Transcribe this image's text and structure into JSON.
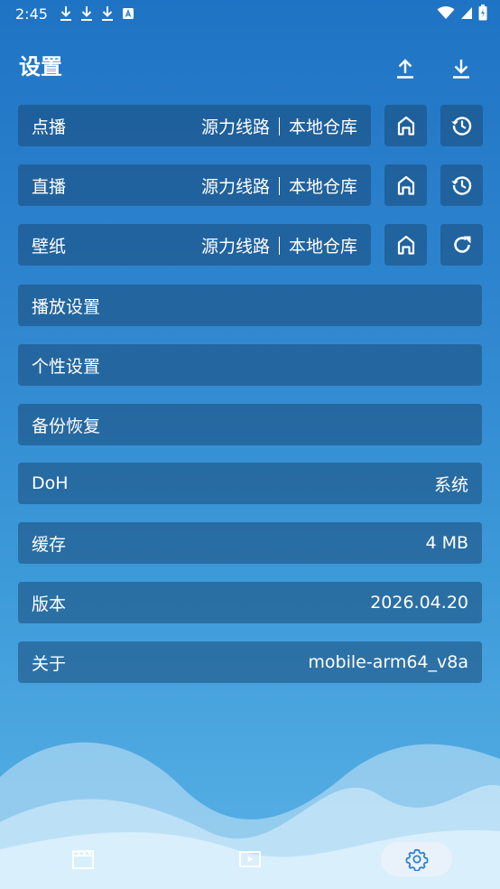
{
  "status_bar": {
    "time": "2:45",
    "left_icons": [
      "download-icon",
      "download-icon",
      "download-icon",
      "translate-icon"
    ],
    "right_icons": [
      "wifi-icon",
      "signal-icon",
      "battery-icon"
    ]
  },
  "header": {
    "title": "设置",
    "actions": [
      "upload-icon",
      "download-icon"
    ]
  },
  "source_rows": [
    {
      "label": "点播",
      "value_a": "源力线路",
      "value_b": "本地仓库",
      "btn1": "home-icon",
      "btn2": "history-icon"
    },
    {
      "label": "直播",
      "value_a": "源力线路",
      "value_b": "本地仓库",
      "btn1": "home-icon",
      "btn2": "history-icon"
    },
    {
      "label": "壁纸",
      "value_a": "源力线路",
      "value_b": "本地仓库",
      "btn1": "home-icon",
      "btn2": "refresh-icon"
    }
  ],
  "settings_rows": [
    {
      "label": "播放设置",
      "value": ""
    },
    {
      "label": "个性设置",
      "value": ""
    },
    {
      "label": "备份恢复",
      "value": ""
    },
    {
      "label": "DoH",
      "value": "系统"
    },
    {
      "label": "缓存",
      "value": "4 MB"
    },
    {
      "label": "版本",
      "value": "2026.04.20"
    },
    {
      "label": "关于",
      "value": "mobile-arm64_v8a"
    }
  ],
  "bottom_nav": {
    "items": [
      "movie-clapper-icon",
      "play-video-icon",
      "settings-gear-icon"
    ],
    "active_index": 2
  },
  "colors": {
    "background_top": "#1f73c4",
    "background_bottom": "#59b2e6",
    "row_fill": "rgba(25,75,120,0.55)",
    "active_nav_pill": "#e9f2fb",
    "active_nav_icon": "#2a7fd0"
  }
}
